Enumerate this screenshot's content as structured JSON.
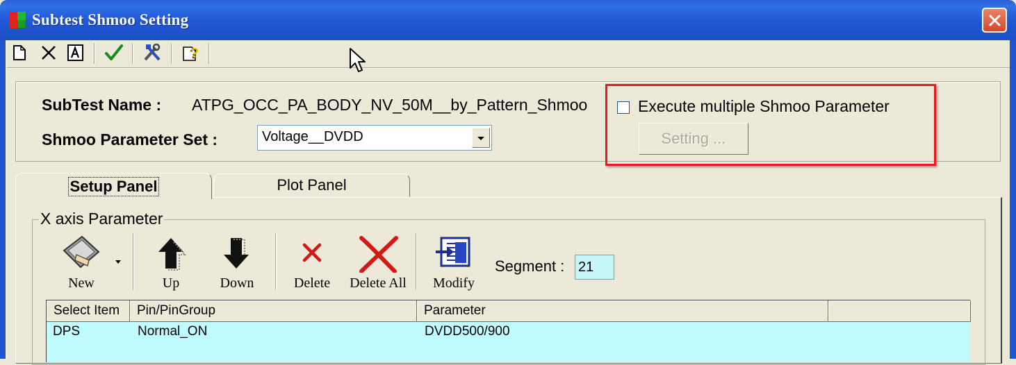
{
  "window": {
    "title": "Subtest Shmoo Setting"
  },
  "toolbar": {
    "icons": [
      "new-file-icon",
      "delete-icon",
      "text-icon",
      "check-icon",
      "tools-icon",
      "help-icon"
    ]
  },
  "header": {
    "subtest_name_label": "SubTest Name :",
    "subtest_name_value": "ATPG_OCC_PA_BODY_NV_50M__by_Pattern_Shmoo",
    "shmoo_set_label": "Shmoo Parameter Set :",
    "shmoo_set_value": "Voltage__DVDD",
    "execute_multiple_label": "Execute multiple Shmoo Parameter",
    "execute_multiple_checked": false,
    "setting_button_label": "Setting ..."
  },
  "tabs": [
    {
      "label": "Setup Panel",
      "active": true
    },
    {
      "label": "Plot Panel",
      "active": false
    }
  ],
  "xaxis": {
    "legend": "X axis Parameter",
    "buttons": {
      "new": "New",
      "up": "Up",
      "down": "Down",
      "delete": "Delete",
      "delete_all": "Delete All",
      "modify": "Modify"
    },
    "segment_label": "Segment :",
    "segment_value": "21"
  },
  "grid": {
    "columns": [
      "Select Item",
      "Pin/PinGroup",
      "Parameter",
      ""
    ],
    "rows": [
      {
        "select_item": "DPS",
        "pin": "Normal_ON",
        "parameter": "DVDD500/900"
      }
    ]
  },
  "colors": {
    "titlebar": "#1f56d2",
    "highlight": "#e31b23",
    "grid_row": "#c0fbff",
    "segment_input": "#c8f7fa"
  }
}
